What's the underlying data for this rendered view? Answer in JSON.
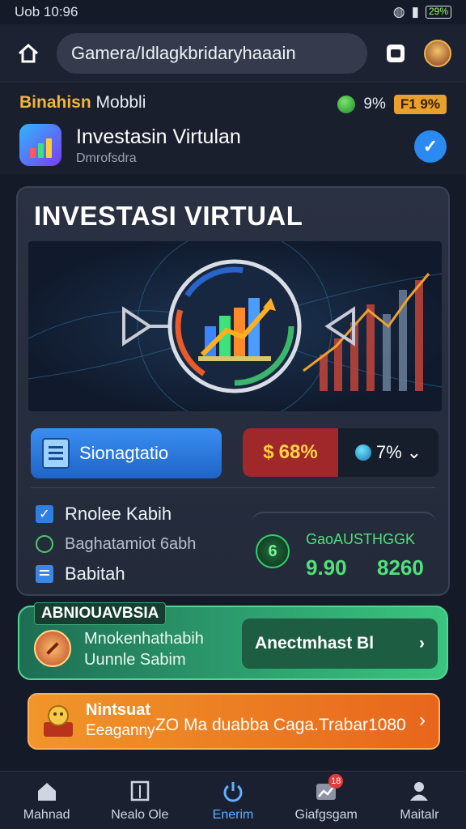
{
  "status": {
    "time": "Uob 10:96",
    "battery": "29%"
  },
  "browser": {
    "url": "Gamera/Idlagkbridaryhaaain"
  },
  "app": {
    "header_title_a": "Binahisn",
    "header_title_b": "Mobbli",
    "chip_percent": "9%",
    "chip_badge": "F1 9%",
    "title": "Investasin Virtulan",
    "subtitle": "Dmrofsdra"
  },
  "card": {
    "heading": "INVESTASI VIRTUAL",
    "primary_button": "Sionagtatio",
    "stat_a": "68%",
    "stat_b": "7%",
    "list": [
      {
        "label": "Rnolee Kabih",
        "icon": "checkbox-icon"
      },
      {
        "label": "Baghatamiot 6abh",
        "icon": "chat-icon"
      },
      {
        "label": "Babitah",
        "icon": "list-icon"
      }
    ],
    "growth_label": "GaoAUSTHGGK",
    "growth_value_1": "9.90",
    "growth_value_2": "8260",
    "growth_icon_char": "6"
  },
  "promo": {
    "tag": "ABNIOUAVBSIA",
    "line1": "Mnokenhathabih",
    "line2": "Uunnle Sabim",
    "button": "Anectmhast Bl"
  },
  "banner": {
    "line1": "Nintsuat",
    "line2": "Eeaganny",
    "text": "ZO Ma duabba Caga.Trabar1080"
  },
  "nav": [
    {
      "label": "Mahnad",
      "icon": "home-icon"
    },
    {
      "label": "Nealo Ole",
      "icon": "book-icon"
    },
    {
      "label": "Enerim",
      "icon": "power-icon"
    },
    {
      "label": "Giafgsgam",
      "icon": "chart-icon",
      "badge": "18"
    },
    {
      "label": "Maitalr",
      "icon": "person-icon"
    }
  ],
  "colors": {
    "accent_blue": "#2f7fe0",
    "accent_green": "#51e07a",
    "accent_orange": "#e8661c",
    "background": "#151a28"
  }
}
